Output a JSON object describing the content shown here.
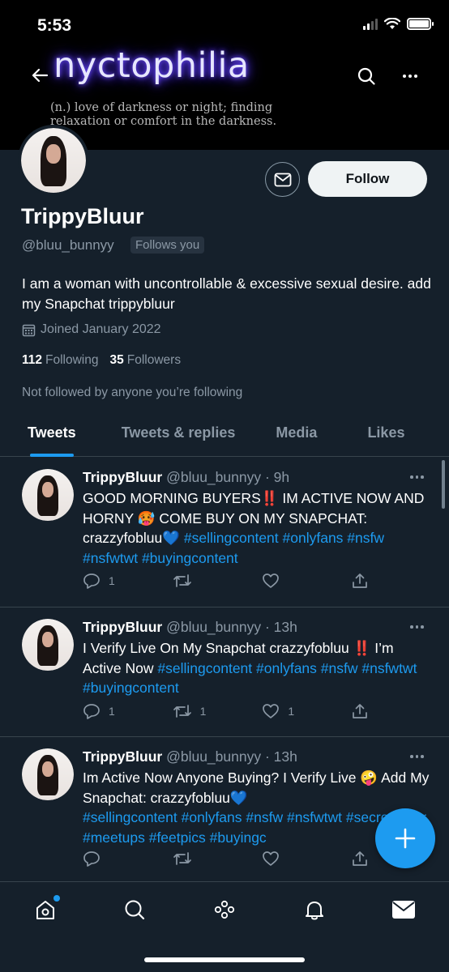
{
  "status_bar": {
    "time": "5:53"
  },
  "banner": {
    "title": "nyctophilia",
    "subtitle": "(n.) love of darkness or night; finding relaxation or comfort in the darkness."
  },
  "profile": {
    "display_name": "TrippyBluur",
    "handle": "@bluu_bunnyy",
    "follows_you": "Follows you",
    "bio": "I am a woman with uncontrollable & excessive sexual desire. add my Snapchat trippybluur",
    "joined": "Joined January 2022",
    "following_count": "112",
    "following_label": "Following",
    "followers_count": "35",
    "followers_label": "Followers",
    "not_followed": "Not followed by anyone you’re following",
    "follow_label": "Follow"
  },
  "tabs": [
    {
      "label": "Tweets",
      "active": true
    },
    {
      "label": "Tweets & replies",
      "active": false
    },
    {
      "label": "Media",
      "active": false
    },
    {
      "label": "Likes",
      "active": false
    }
  ],
  "tweets": [
    {
      "name": "TrippyBluur",
      "meta": "@bluu_bunnyy · 9h",
      "text_1": "GOOD MORNING BUYERS‼️ IM ACTIVE NOW AND HORNY 🥵 COME BUY ON MY SNAPCHAT: crazzyfobluu💙 ",
      "hashtags_1": "#sellingcontent #onlyfans #nsfw #nsfwtwt #buyingcontent",
      "replies": "1",
      "retweets": "",
      "likes": ""
    },
    {
      "name": "TrippyBluur",
      "meta": "@bluu_bunnyy · 13h",
      "text_1": "I Verify Live On My Snapchat crazzyfobluu ‼️ I’m Active Now ",
      "hashtags_1": "#sellingcontent #onlyfans #nsfw #nsfwtwt #buyingcontent",
      "replies": "1",
      "retweets": "1",
      "likes": "1"
    },
    {
      "name": "TrippyBluur",
      "meta": "@bluu_bunnyy · 13h",
      "text_1": "Im Active Now Anyone Buying? I Verify  Live 🤪 Add My Snapchat: crazzyfobluu💙",
      "hashtags_1": "#sellingcontent #onlyfans #nsfw #nsfwtwt #secretseller #meetups #feetpics #buyingc",
      "replies": "",
      "retweets": "",
      "likes": ""
    }
  ],
  "icons": {
    "back": "arrow-left-icon",
    "search": "search-icon",
    "more": "more-icon",
    "message": "envelope-icon",
    "calendar": "calendar-icon",
    "reply": "reply-icon",
    "retweet": "retweet-icon",
    "like": "heart-icon",
    "share": "share-icon",
    "compose": "plus-icon",
    "home": "home-icon",
    "explore": "search-icon",
    "spaces": "spaces-icon",
    "notifications": "bell-icon",
    "messages": "envelope-icon"
  },
  "colors": {
    "accent": "#1d9bf0",
    "background": "#15202b",
    "muted": "#8b98a5"
  }
}
